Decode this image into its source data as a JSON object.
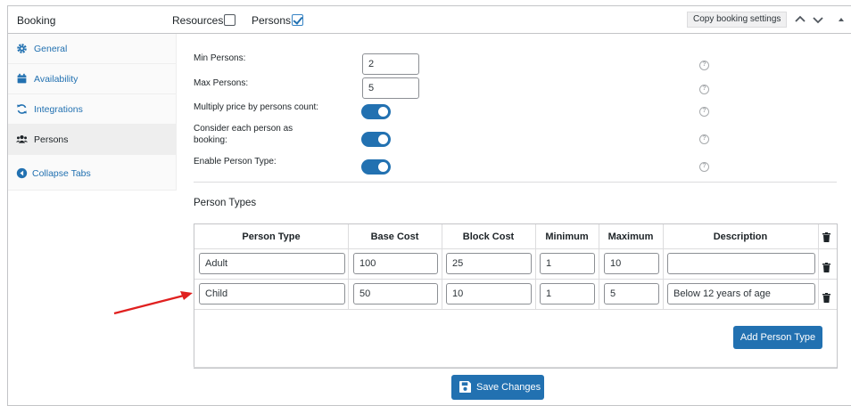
{
  "header": {
    "title": "Booking",
    "resources_label": "Resources:",
    "resources_checked": false,
    "persons_label": "Persons:",
    "persons_checked": true,
    "copy_label": "Copy booking settings",
    "icons": [
      "chevron-up-icon",
      "chevron-down-icon",
      "caret-up-icon"
    ]
  },
  "sidebar": {
    "items": [
      {
        "label": "General",
        "icon": "gear-icon"
      },
      {
        "label": "Availability",
        "icon": "calendar-icon"
      },
      {
        "label": "Integrations",
        "icon": "sync-icon"
      },
      {
        "label": "Persons",
        "icon": "users-icon",
        "active": true
      },
      {
        "label": "Collapse Tabs",
        "icon": "collapse-icon"
      }
    ]
  },
  "settings": {
    "min_persons_label": "Min Persons:",
    "min_persons_value": "2",
    "max_persons_label": "Max Persons:",
    "max_persons_value": "5",
    "multiply_label": "Multiply price by persons count:",
    "multiply_on": true,
    "consider_label_1": "Consider each person as",
    "consider_label_2": "booking:",
    "consider_on": true,
    "enable_type_label": "Enable Person Type:",
    "enable_type_on": true,
    "help_glyph": "?"
  },
  "person_types": {
    "title": "Person Types",
    "columns": [
      "Person Type",
      "Base Cost",
      "Block Cost",
      "Minimum",
      "Maximum",
      "Description"
    ],
    "rows": [
      {
        "type": "Adult",
        "base": "100",
        "block": "25",
        "min": "1",
        "max": "10",
        "desc": ""
      },
      {
        "type": "Child",
        "base": "50",
        "block": "10",
        "min": "1",
        "max": "5",
        "desc": "Below 12 years of age"
      }
    ],
    "add_label": "Add Person Type"
  },
  "save_label": "Save Changes",
  "colors": {
    "accent": "#2271b1",
    "arrow": "#e0201f"
  }
}
